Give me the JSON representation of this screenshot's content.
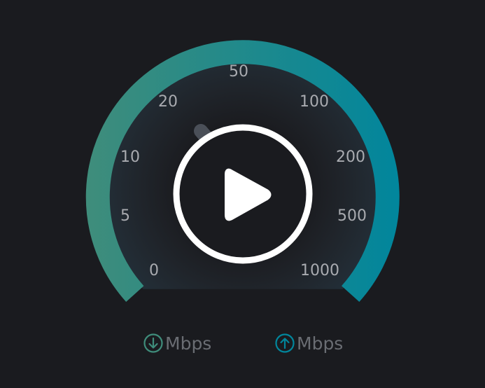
{
  "speedometer": {
    "tick_labels": [
      "0",
      "5",
      "10",
      "20",
      "50",
      "100",
      "200",
      "500",
      "1000"
    ],
    "needle_value": "20",
    "colors": {
      "arc_start": "#3f8d7b",
      "arc_end": "#01869c",
      "needle": "#4a4f58",
      "ticks": "#a9abb0",
      "play_button": "#ffffff"
    }
  },
  "play_button": {
    "icon": "play-icon"
  },
  "download": {
    "icon": "arrow-down-circle-icon",
    "unit": "Mbps",
    "color": "#3f8d7b"
  },
  "upload": {
    "icon": "arrow-up-circle-icon",
    "unit": "Mbps",
    "color": "#01869c"
  }
}
